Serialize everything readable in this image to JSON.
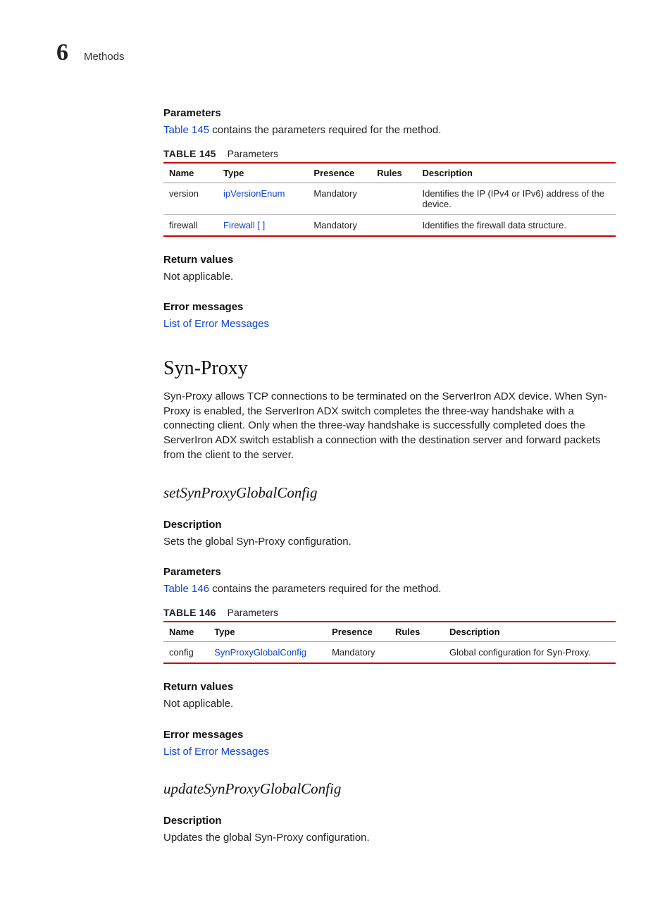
{
  "header": {
    "chapter": "6",
    "title": "Methods"
  },
  "sections": {
    "parameters1": {
      "heading": "Parameters",
      "intro_link": "Table 145",
      "intro_rest": " contains the parameters required for the method.",
      "caption_label": "TABLE 145",
      "caption_text": "Parameters"
    },
    "return1": {
      "heading": "Return values",
      "body": "Not applicable."
    },
    "error1": {
      "heading": "Error messages",
      "link": "List of Error Messages"
    },
    "synProxy": {
      "heading": "Syn-Proxy",
      "body": "Syn-Proxy allows TCP connections to be terminated on the ServerIron ADX device. When Syn-Proxy is enabled, the ServerIron ADX switch completes the three-way handshake with a connecting client. Only when the three-way handshake is successfully completed does the ServerIron ADX switch establish a connection with the destination server and forward packets from the client to the server."
    },
    "setSyn": {
      "heading": "setSynProxyGlobalConfig",
      "desc_heading": "Description",
      "desc_body": "Sets the global Syn-Proxy configuration.",
      "params_heading": "Parameters",
      "params_intro_link": "Table 146",
      "params_intro_rest": " contains the parameters required for the method.",
      "caption_label": "TABLE 146",
      "caption_text": "Parameters",
      "return_heading": "Return values",
      "return_body": "Not applicable.",
      "error_heading": "Error messages",
      "error_link": "List of Error Messages"
    },
    "updateSyn": {
      "heading": "updateSynProxyGlobalConfig",
      "desc_heading": "Description",
      "desc_body": "Updates the global Syn-Proxy configuration."
    }
  },
  "tables": {
    "t145": {
      "cols": [
        "Name",
        "Type",
        "Presence",
        "Rules",
        "Description"
      ],
      "rows": [
        {
          "name": "version",
          "type": "ipVersionEnum",
          "presence": "Mandatory",
          "rules": "",
          "desc": "Identifies the IP (IPv4 or IPv6) address of the device."
        },
        {
          "name": "firewall",
          "type": "Firewall [ ]",
          "presence": "Mandatory",
          "rules": "",
          "desc": "Identifies the firewall data structure."
        }
      ]
    },
    "t146": {
      "cols": [
        "Name",
        "Type",
        "Presence",
        "Rules",
        "Description"
      ],
      "rows": [
        {
          "name": "config",
          "type": "SynProxyGlobalConfig",
          "presence": "Mandatory",
          "rules": "",
          "desc": "Global configuration for Syn-Proxy."
        }
      ]
    }
  }
}
